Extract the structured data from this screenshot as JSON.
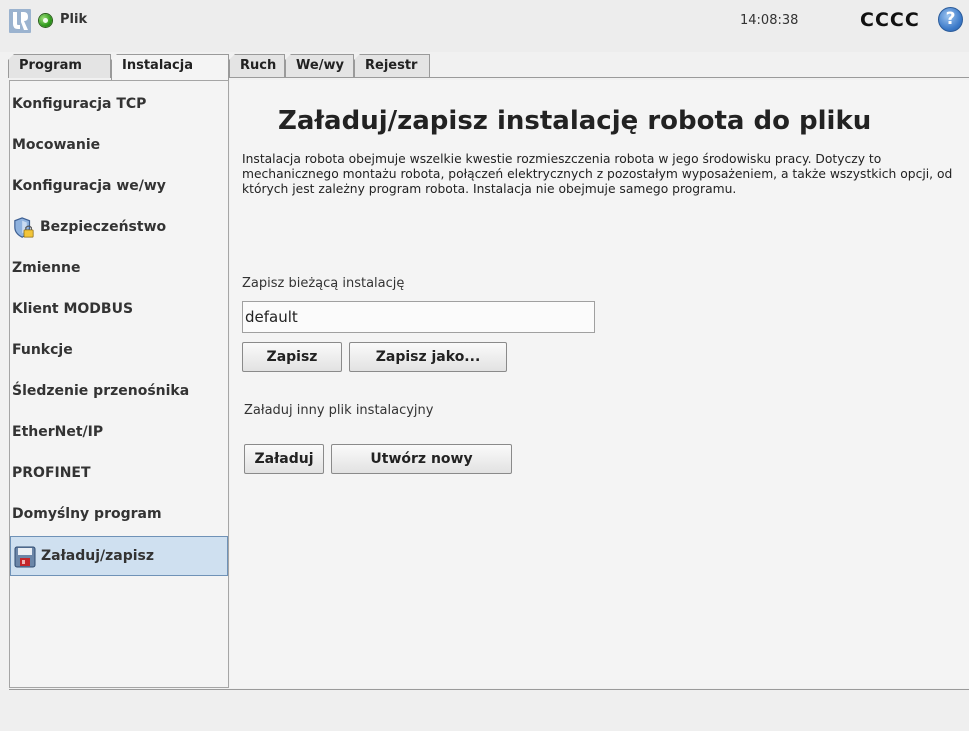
{
  "header": {
    "file_label": "Plik",
    "time": "14:08:38",
    "robot_name": "CCCC",
    "help_glyph": "?"
  },
  "tabs": [
    {
      "label": "Program"
    },
    {
      "label": "Instalacja",
      "active": true
    },
    {
      "label": "Ruch"
    },
    {
      "label": "We/wy"
    },
    {
      "label": "Rejestr"
    }
  ],
  "sidebar": {
    "items": [
      {
        "label": "Konfiguracja TCP"
      },
      {
        "label": "Mocowanie"
      },
      {
        "label": "Konfiguracja we/wy"
      },
      {
        "label": "Bezpieczeństwo",
        "icon": "shield-lock-icon"
      },
      {
        "label": "Zmienne"
      },
      {
        "label": "Klient MODBUS"
      },
      {
        "label": "Funkcje"
      },
      {
        "label": "Śledzenie przenośnika"
      },
      {
        "label": "EtherNet/IP"
      },
      {
        "label": "PROFINET"
      },
      {
        "label": "Domyślny program"
      },
      {
        "label": "Załaduj/zapisz",
        "icon": "floppy-disk-icon",
        "selected": true
      }
    ]
  },
  "main": {
    "title": "Załaduj/zapisz instalację robota do pliku",
    "description": "Instalacja robota obejmuje wszelkie kwestie rozmieszczenia robota w jego środowisku pracy. Dotyczy to mechanicznego montażu robota, połączeń elektrycznych z pozostałym wyposażeniem, a także wszystkich opcji, od których jest zależny program robota. Instalacja nie obejmuje samego programu.",
    "save_label": "Zapisz bieżącą instalację",
    "installation_name": "default",
    "save_button": "Zapisz",
    "save_as_button": "Zapisz jako...",
    "load_label": "Załaduj inny plik instalacyjny",
    "load_button": "Załaduj",
    "create_new_button": "Utwórz nowy"
  },
  "colors": {
    "status": "#2f9a1c",
    "selected_bg": "#cfe0f0",
    "help": "#3b79c8"
  }
}
